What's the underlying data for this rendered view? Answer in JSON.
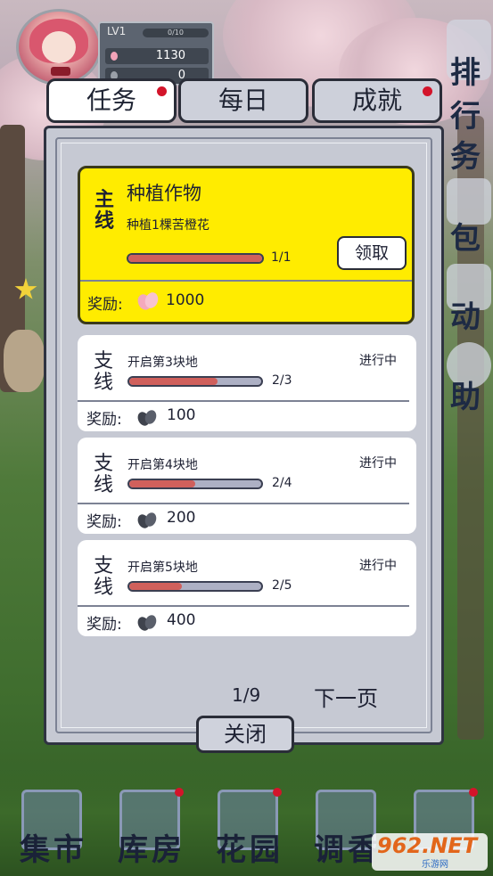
{
  "player": {
    "level": "LV1",
    "exp": "0/10",
    "stat1": "1130",
    "stat2": "0"
  },
  "side_menu": [
    "排行",
    "务",
    "包",
    "动",
    "助"
  ],
  "tabs": [
    {
      "label": "任务",
      "active": true,
      "dot": true
    },
    {
      "label": "每日",
      "active": false,
      "dot": false
    },
    {
      "label": "成就",
      "active": false,
      "dot": true
    }
  ],
  "main_quest": {
    "kind": "主线",
    "title": "种植作物",
    "desc": "种植1棵苦橙花",
    "progress_text": "1/1",
    "progress": 1.0,
    "claim_label": "领取",
    "reward_label": "奖励:",
    "reward_value": "1000"
  },
  "side_quests": [
    {
      "kind": "支线",
      "title": "开启第3块地",
      "status": "进行中",
      "progress_text": "2/3",
      "progress": 0.667,
      "reward_label": "奖励:",
      "reward_value": "100"
    },
    {
      "kind": "支线",
      "title": "开启第4块地",
      "status": "进行中",
      "progress_text": "2/4",
      "progress": 0.5,
      "reward_label": "奖励:",
      "reward_value": "200"
    },
    {
      "kind": "支线",
      "title": "开启第5块地",
      "status": "进行中",
      "progress_text": "2/5",
      "progress": 0.4,
      "reward_label": "奖励:",
      "reward_value": "400"
    }
  ],
  "pager": {
    "page": "1/9",
    "next_label": "下一页"
  },
  "close_label": "关闭",
  "bottom_nav": [
    {
      "label": "集市",
      "dot": false
    },
    {
      "label": "库房",
      "dot": true
    },
    {
      "label": "花园",
      "dot": true
    },
    {
      "label": "调香",
      "dot": false
    },
    {
      "label": "",
      "dot": true
    }
  ],
  "watermark": {
    "logo": "962.NET",
    "sub": "乐游网"
  },
  "colors": {
    "accent_yellow": "#ffec00",
    "progress_fill": "#d0605c",
    "red_dot": "#d3142a"
  }
}
